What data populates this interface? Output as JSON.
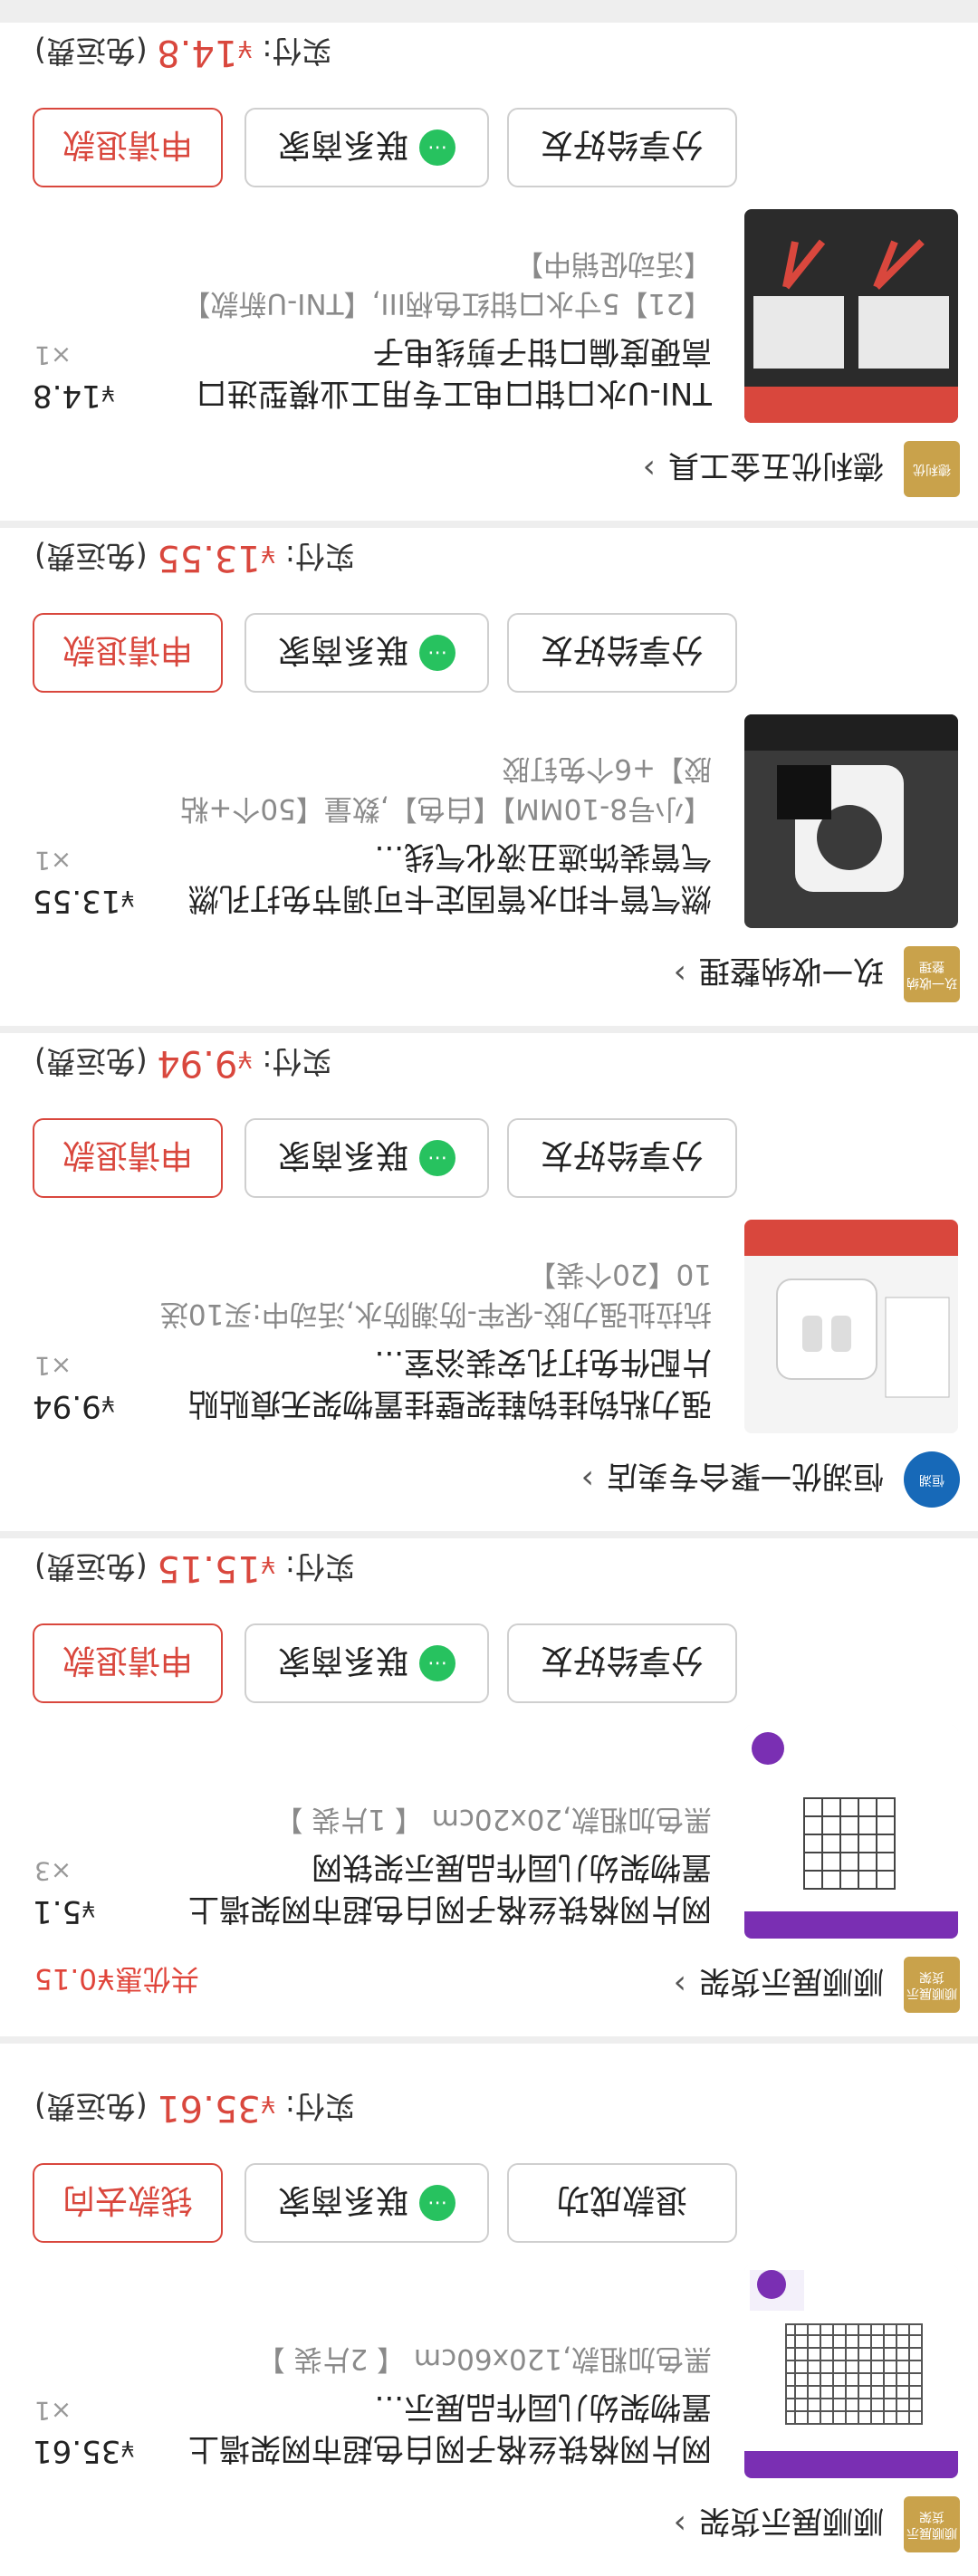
{
  "orders": [
    {
      "store": {
        "logo_text": "顺顺展示货架",
        "name": "顺顺展示货架"
      },
      "discount": "",
      "product": {
        "title": "网片网格铁丝格子网白色超市网架墙上置物架幼儿园作品展示...",
        "spec": "黑色加粗款,120x60cm 【 2片装 】",
        "price": "35.61",
        "qty": "×1"
      },
      "buttons": {
        "share": "退款成功",
        "contact": "联系商家",
        "refund": "钱款去向"
      },
      "paid": {
        "label": "实付:",
        "amount": "35.61",
        "note": "(免运费)"
      }
    },
    {
      "store": {
        "logo_text": "顺顺展示货架",
        "name": "顺顺展示货架"
      },
      "discount": "共优惠¥0.15",
      "product": {
        "title": "网片网格铁丝格子网白色超市网架墙上置物架幼儿园作品展示架铁网",
        "spec": "黑色加粗款,20x20cm 【 1片装 】",
        "price": "5.1",
        "qty": "×3"
      },
      "buttons": {
        "share": "分享给好友",
        "contact": "联系商家",
        "refund": "申请退款"
      },
      "paid": {
        "label": "实付:",
        "amount": "15.15",
        "note": "(免运费)"
      }
    },
    {
      "store": {
        "logo_text": "恒湖",
        "name": "恒湖优一聚合专卖店"
      },
      "discount": "",
      "product": {
        "title": "强力粘钩挂钩鞋架壁挂置物架无痕贴贴片配件免打孔安装浴室...",
        "spec": "抗拉扯强力胶-保牢-防潮防水,活动中:买10送10【20个装】",
        "price": "9.94",
        "qty": "×1"
      },
      "buttons": {
        "share": "分享给好友",
        "contact": "联系商家",
        "refund": "申请退款"
      },
      "paid": {
        "label": "实付:",
        "amount": "9.94",
        "note": "(免运费)"
      }
    },
    {
      "store": {
        "logo_text": "玖一收纳整理",
        "name": "玖一收纳整理"
      },
      "discount": "",
      "product": {
        "title": "燃气管卡扣水管固定卡可调节免打孔燃气管装饰遮丑液化气线...",
        "spec": "【小号8-10MM】【白色】,数量【50个+粘胶】+6个免钉胶",
        "price": "13.55",
        "qty": "×1"
      },
      "buttons": {
        "share": "分享给好友",
        "contact": "联系商家",
        "refund": "申请退款"
      },
      "paid": {
        "label": "实付:",
        "amount": "13.55",
        "note": "(免运费)"
      }
    },
    {
      "store": {
        "logo_text": "德利优",
        "name": "德利优五金工具"
      },
      "discount": "",
      "product": {
        "title": "TNI-U水口钳口电工专用工业模型进口高硬度偏口钳子剪线电子",
        "spec": "【21】5寸水口钳红色柄III,【TNI-U新款】【活动促销中】",
        "price": "14.8",
        "qty": "×1"
      },
      "buttons": {
        "share": "分享给好友",
        "contact": "联系商家",
        "refund": "申请退款"
      },
      "paid": {
        "label": "实付:",
        "amount": "14.8",
        "note": "(免运费)"
      }
    }
  ],
  "currency": "¥",
  "colors": {
    "accent": "#d9473d",
    "wechat": "#27c25f",
    "store_badge": "#c9a24b"
  }
}
